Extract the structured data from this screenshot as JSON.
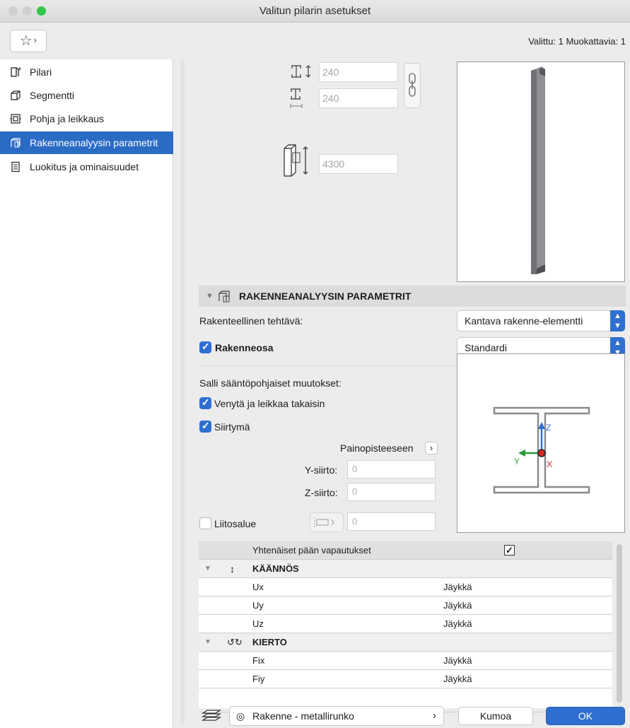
{
  "window": {
    "title": "Valitun pilarin asetukset"
  },
  "header": {
    "selection_info": "Valittu: 1 Muokattavia: 1"
  },
  "sidebar": {
    "items": [
      {
        "label": "Pilari",
        "icon": "column-icon"
      },
      {
        "label": "Segmentti",
        "icon": "segment-icon"
      },
      {
        "label": "Pohja ja leikkaus",
        "icon": "floorplan-icon"
      },
      {
        "label": "Rakenneanalyysin parametrit",
        "icon": "structural-analysis-icon",
        "selected": true
      },
      {
        "label": "Luokitus ja ominaisuudet",
        "icon": "classification-icon"
      }
    ]
  },
  "dimensions": {
    "width": "240",
    "depth": "240",
    "height": "4300"
  },
  "section": {
    "title": "RAKENNEANALYYSIN PARAMETRIT",
    "structural_function_label": "Rakenteellinen tehtävä:",
    "structural_function_value": "Kantava rakenne-elementti",
    "structural_member_label": "Rakenneosa",
    "structural_member_value": "Standardi",
    "rule_changes_label": "Salli sääntöpohjaiset muutokset:",
    "extend_trim_label": "Venytä ja leikkaa takaisin",
    "offset_label": "Siirtymä",
    "centroid_label": "Painopisteeseen",
    "y_offset_label": "Y-siirto:",
    "y_offset_value": "0",
    "z_offset_label": "Z-siirto:",
    "z_offset_value": "0",
    "connection_zone_label": "Liitosalue",
    "connection_zone_value": "0"
  },
  "axes": {
    "z": "Z",
    "y": "Y",
    "x": "X"
  },
  "table": {
    "header_label": "Yhtenäiset pään vapautukset",
    "groups": [
      {
        "title": "KÄÄNNÖS",
        "rows": [
          {
            "name": "Ux",
            "value": "Jäykkä"
          },
          {
            "name": "Uy",
            "value": "Jäykkä"
          },
          {
            "name": "Uz",
            "value": "Jäykkä"
          }
        ]
      },
      {
        "title": "KIERTO",
        "rows": [
          {
            "name": "Fix",
            "value": "Jäykkä"
          },
          {
            "name": "Fiy",
            "value": "Jäykkä"
          }
        ]
      }
    ]
  },
  "footer": {
    "layer": "Rakenne - metallirunko",
    "cancel": "Kumoa",
    "ok": "OK"
  },
  "colors": {
    "accent": "#2f6fd0",
    "selected": "#2a6bc4"
  }
}
